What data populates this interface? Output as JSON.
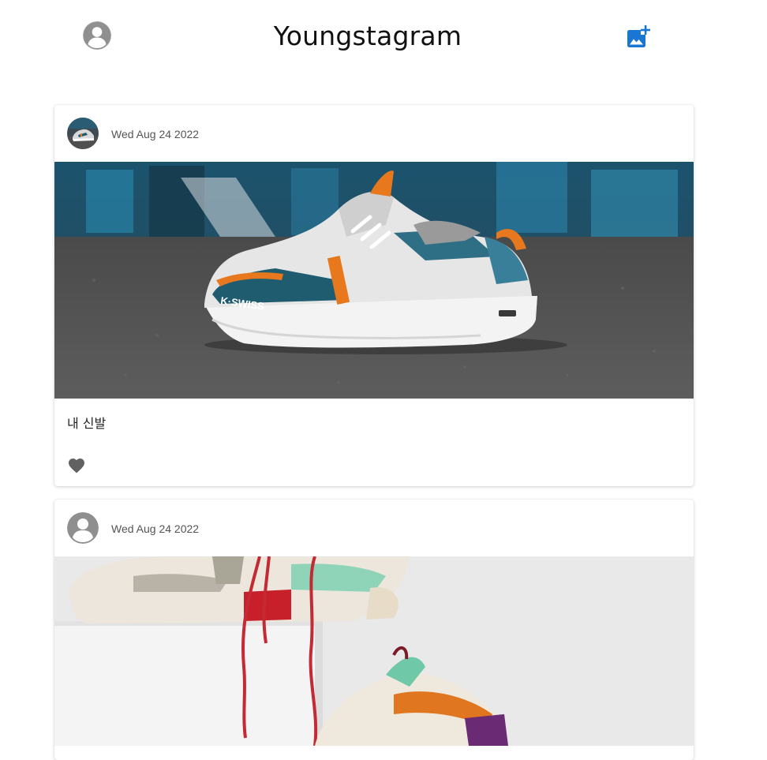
{
  "header": {
    "title": "Youngstagram",
    "profile_icon": "account-circle-icon",
    "add_icon": "add-photo-icon",
    "accent_color": "#1976d2"
  },
  "posts": [
    {
      "date": "Wed Aug 24 2022",
      "caption": "내 신발",
      "image": "sneaker-photo",
      "avatar": "sneaker-thumbnail",
      "like_icon": "heart-icon"
    },
    {
      "date": "Wed Aug 24 2022",
      "image": "sneakers-on-box-photo",
      "avatar": "default-avatar-icon"
    }
  ]
}
